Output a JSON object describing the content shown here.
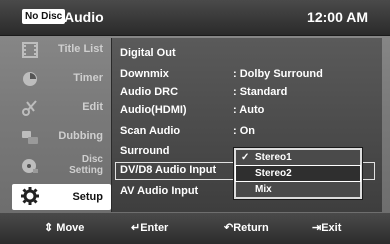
{
  "header": {
    "badge": "No Disc",
    "title": "Audio",
    "time": "12:00 AM"
  },
  "sidebar": {
    "items": [
      {
        "label": "Title List",
        "icon": "film-icon"
      },
      {
        "label": "Timer",
        "icon": "timer-icon"
      },
      {
        "label": "Edit",
        "icon": "scissors-icon"
      },
      {
        "label": "Dubbing",
        "icon": "dubbing-icon"
      },
      {
        "label": "Disc Setting",
        "line1": "Disc",
        "line2": "Setting",
        "icon": "disc-icon"
      },
      {
        "label": "Setup",
        "icon": "gear-icon"
      }
    ]
  },
  "settings": [
    {
      "name": "Digital Out",
      "value": ""
    },
    {
      "name": "Downmix",
      "value": ": Dolby Surround"
    },
    {
      "name": "Audio DRC",
      "value": ": Standard"
    },
    {
      "name": "Audio(HDMI)",
      "value": ": Auto"
    },
    {
      "name": "Scan Audio",
      "value": ": On"
    },
    {
      "name": "Surround",
      "value": ":"
    },
    {
      "name": "DV/D8 Audio Input",
      "value": ":"
    },
    {
      "name": "AV Audio Input",
      "value": ":"
    }
  ],
  "dropdown": {
    "options": [
      "Stereo1",
      "Stereo2",
      "Mix"
    ],
    "checked": "Stereo1",
    "highlighted": "Stereo2"
  },
  "footer": {
    "move": "Move",
    "enter": "Enter",
    "return": "Return",
    "exit": "Exit"
  }
}
